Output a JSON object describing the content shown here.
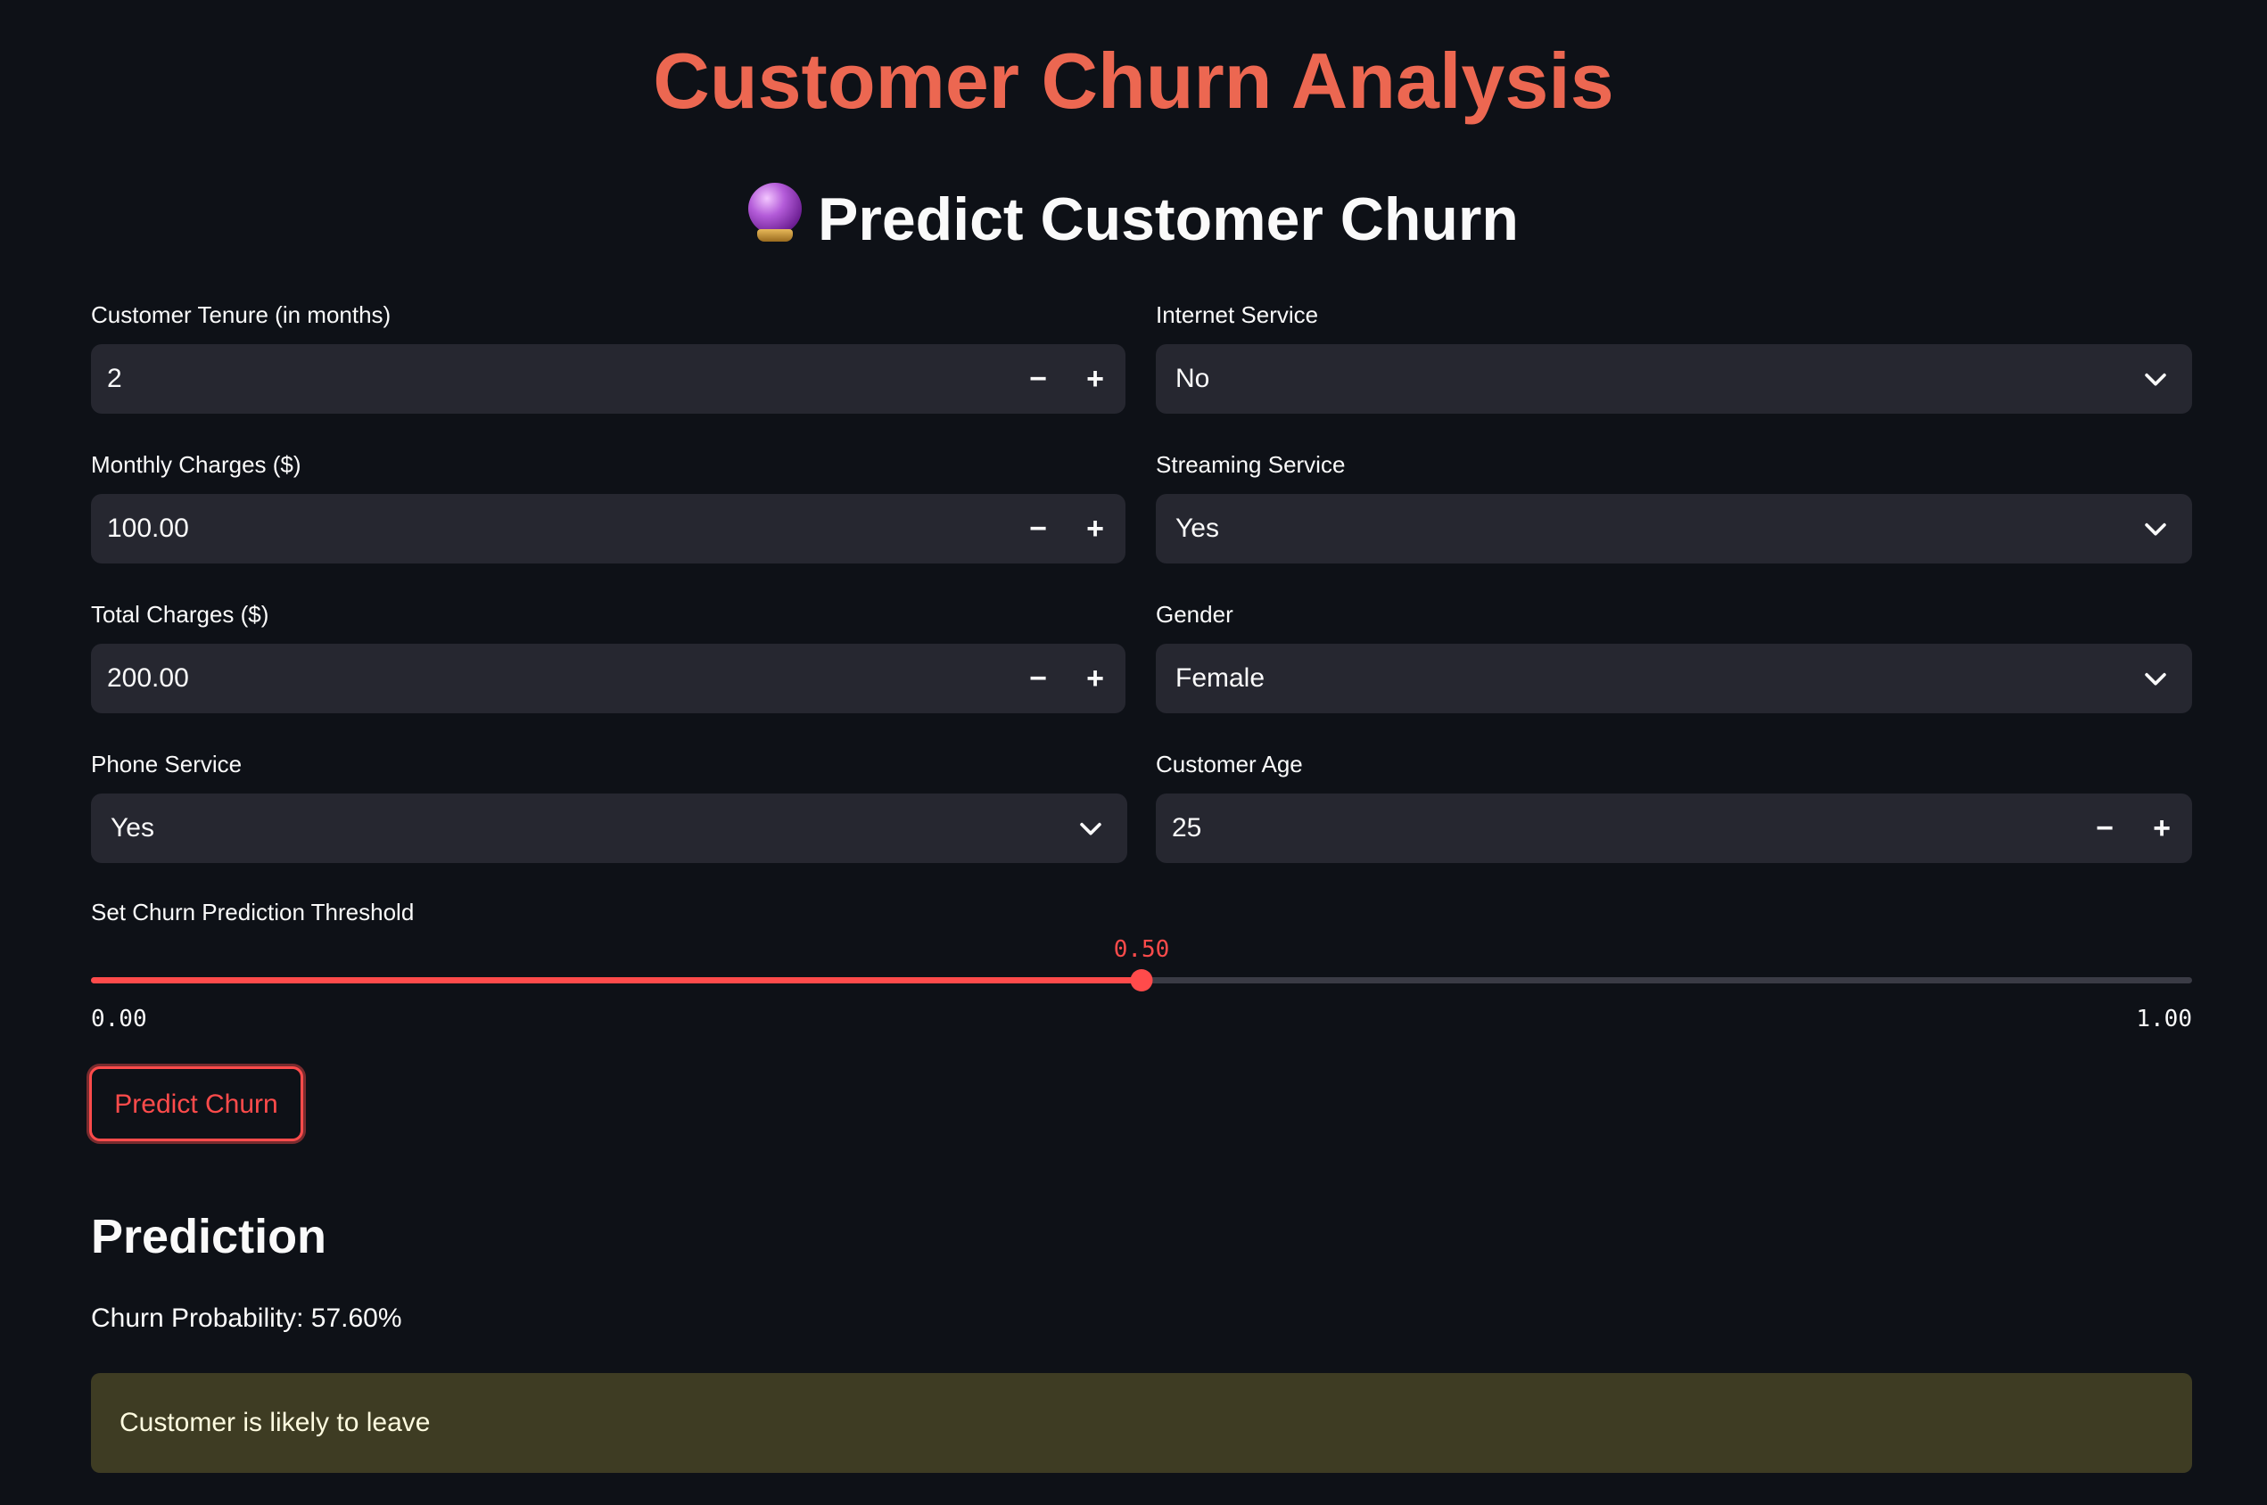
{
  "page": {
    "title": "Customer Churn Analysis",
    "subtitle": "Predict Customer Churn",
    "subtitle_icon": "crystal-ball-icon"
  },
  "form": {
    "tenure": {
      "label": "Customer Tenure (in months)",
      "value": "2"
    },
    "monthly_charges": {
      "label": "Monthly Charges ($)",
      "value": "100.00"
    },
    "total_charges": {
      "label": "Total Charges ($)",
      "value": "200.00"
    },
    "phone_service": {
      "label": "Phone Service",
      "value": "Yes"
    },
    "internet_service": {
      "label": "Internet Service",
      "value": "No"
    },
    "streaming_service": {
      "label": "Streaming Service",
      "value": "Yes"
    },
    "gender": {
      "label": "Gender",
      "value": "Female"
    },
    "customer_age": {
      "label": "Customer Age",
      "value": "25"
    },
    "stepper_minus": "−",
    "stepper_plus": "+"
  },
  "threshold": {
    "label": "Set Churn Prediction Threshold",
    "value": 0.5,
    "value_text": "0.50",
    "min_text": "0.00",
    "max_text": "1.00",
    "min": 0,
    "max": 1
  },
  "predict_button": {
    "label": "Predict Churn"
  },
  "prediction": {
    "heading": "Prediction",
    "probability_text": "Churn Probability: 57.60%",
    "message": "Customer is likely to leave"
  },
  "colors": {
    "background": "#0e1117",
    "title": "#ec6751",
    "accent": "#ff4b4b",
    "input_bg": "#262730",
    "warning_bg": "#3e3c23",
    "warning_text": "#fffce0"
  }
}
